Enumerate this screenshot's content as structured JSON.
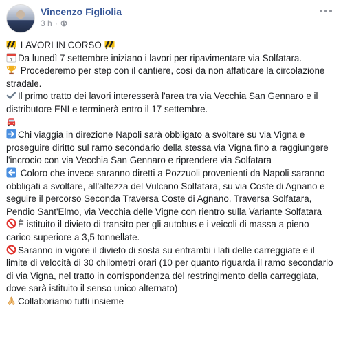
{
  "post": {
    "author": "Vincenzo Figliolia",
    "time": "3 h",
    "separator": "·",
    "privacy_icon": "globe-icon",
    "more_icon": "more-options-icon",
    "lines": [
      {
        "icon": "construction-sign-icon",
        "text": " LAVORI IN CORSO ",
        "icon_after": "construction-sign-icon"
      },
      {
        "icon": "calendar-icon",
        "text": "Da lunedì 7 settembre iniziano i lavori per ripavimentare via Solfatara."
      },
      {
        "icon": "trophy-icon",
        "text": " Procederemo per step con il cantiere, così da non affaticare la circolazione stradale."
      },
      {
        "icon": "check-mark-icon",
        "text": "Il primo tratto dei lavori interesserà l'area tra via Vecchia San Gennaro e il distributore ENI e terminerà entro il 17 settembre."
      },
      {
        "icon": "car-icon",
        "text": ""
      },
      {
        "icon": "right-arrow-icon",
        "text": "Chi viaggia in direzione Napoli sarà obbligato a svoltare su via Vigna e proseguire diritto sul ramo secondario della stessa via Vigna fino a raggiungere l'incrocio con via Vecchia San Gennaro e riprendere via Solfatara"
      },
      {
        "icon": "left-arrow-icon",
        "text": " Coloro che invece saranno diretti a Pozzuoli provenienti da Napoli saranno obbligati a svoltare, all'altezza del Vulcano Solfatara, su via Coste di Agnano e seguire il percorso Seconda Traversa Coste di Agnano, Traversa Solfatara, Pendio Sant'Elmo, via Vecchia delle Vigne con rientro sulla Variante Solfatara"
      },
      {
        "icon": "prohibited-icon",
        "text": "È istituito il divieto di transito per gli autobus e i veicoli di massa a pieno carico superiore a 3,5 tonnellate."
      },
      {
        "icon": "prohibited-icon",
        "text": "Saranno in vigore il divieto di sosta su entrambi i lati delle carreggiate e il limite di velocità di 30 chilometri orari (10 per quanto riguarda il ramo secondario di via Vigna, nel tratto in corrispondenza del restringimento della carreggiata, dove sarà istituito il senso unico alternato)"
      },
      {
        "icon": "folded-hands-icon",
        "text": "Collaboriamo tutti insieme"
      }
    ]
  }
}
